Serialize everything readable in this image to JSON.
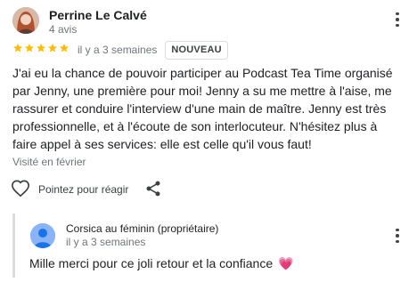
{
  "review": {
    "author": "Perrine Le Calvé",
    "author_meta": "4 avis",
    "rating": 5,
    "time_ago": "il y a 3 semaines",
    "badge": "NOUVEAU",
    "text": "J'ai eu la chance de pouvoir participer au Podcast Tea Time organisé par Jenny, une première pour moi! Jenny a su me mettre à l'aise, me rassurer et conduire l'interview d'une main de maître. Jenny est très professionnelle, et à l'écoute de son interlocuteur. N'hésitez plus à faire appel à ses services: elle est celle qu'il vous faut!",
    "visited": "Visité en février",
    "star_color": "#fbbc04",
    "icons": [
      "profile-photo",
      "more-options-icon",
      "star-icon",
      "heart-outline-icon",
      "share-icon"
    ]
  },
  "actions": {
    "react_label": "Pointez pour réagir"
  },
  "reply": {
    "author": "Corsica au féminin (propriétaire)",
    "time_ago": "il y a 3 semaines",
    "text": "Mille merci pour ce joli retour et la confiance",
    "emoji": "💗",
    "icons": [
      "person-avatar-icon",
      "more-options-icon"
    ]
  }
}
